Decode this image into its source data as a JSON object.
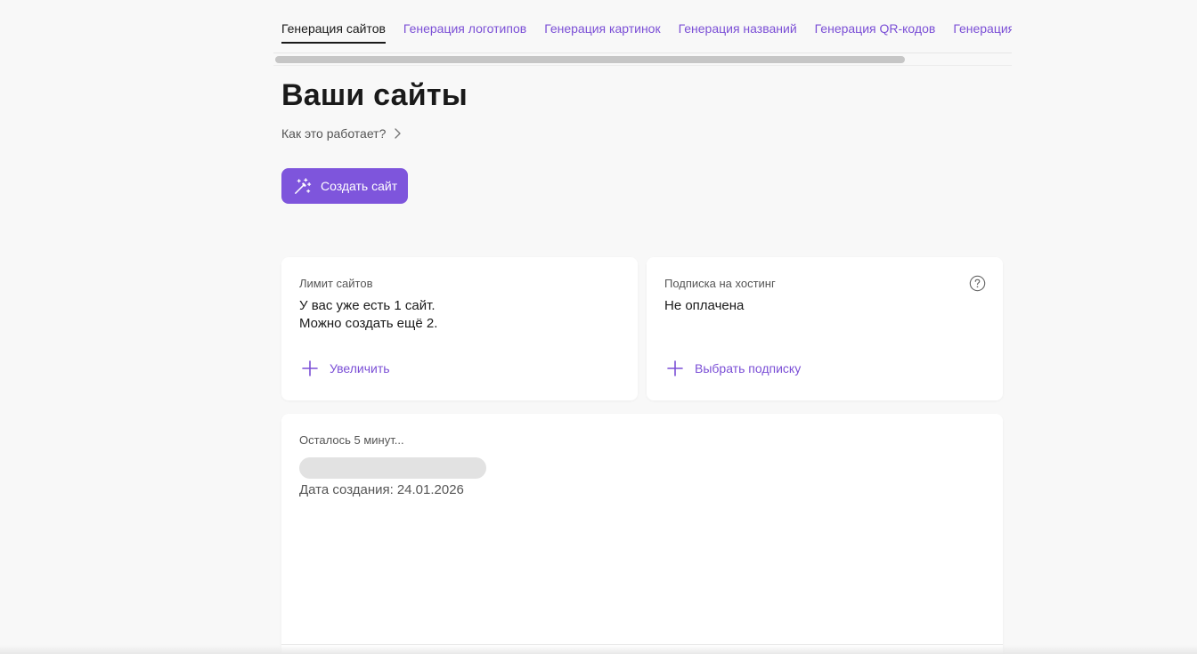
{
  "tabs": [
    {
      "label": "Генерация сайтов",
      "active": true
    },
    {
      "label": "Генерация логотипов",
      "active": false
    },
    {
      "label": "Генерация картинок",
      "active": false
    },
    {
      "label": "Генерация названий",
      "active": false
    },
    {
      "label": "Генерация QR-кодов",
      "active": false
    },
    {
      "label": "Генерация",
      "active": false
    }
  ],
  "page": {
    "title": "Ваши сайты",
    "how_link": "Как это работает?",
    "create_button": "Создать сайт"
  },
  "limit_card": {
    "label": "Лимит сайтов",
    "line1": "У вас уже есть 1 сайт.",
    "line2": "Можно создать ещё 2.",
    "action": "Увеличить"
  },
  "hosting_card": {
    "label": "Подписка на хостинг",
    "value": "Не оплачена",
    "action": "Выбрать подписку"
  },
  "site_card": {
    "status": "Осталось 5 минут...",
    "date_label": "Дата создания:",
    "date_value": "24.01.2026"
  },
  "colors": {
    "accent": "#7e55dc",
    "link": "#7b4fd6",
    "background": "#f8f8f8"
  },
  "icons": [
    "magic-wand-icon",
    "chevron-right-icon",
    "plus-icon",
    "help-circle-icon"
  ]
}
